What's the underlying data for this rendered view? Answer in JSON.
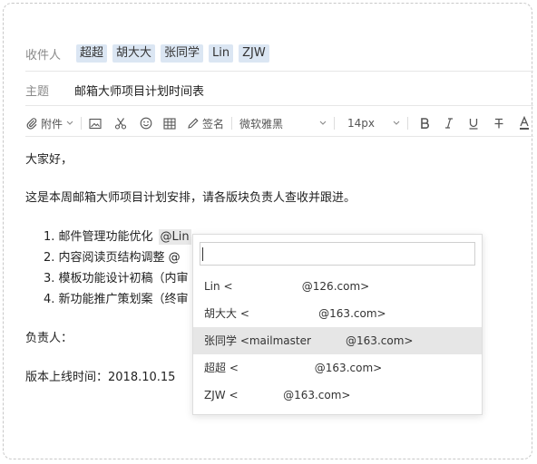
{
  "recipients": {
    "label": "收件人",
    "chips": [
      "超超",
      "胡大大",
      "张同学",
      "Lin",
      "ZJW"
    ]
  },
  "subject": {
    "label": "主题",
    "value": "邮箱大师项目计划时间表"
  },
  "toolbar": {
    "attach_label": "附件",
    "signature_label": "签名",
    "font_family": "微软雅黑",
    "font_size": "14px",
    "icons": [
      "paperclip-icon",
      "image-icon",
      "scissors-icon",
      "emoji-icon",
      "table-icon",
      "pen-icon",
      "bold-icon",
      "italic-icon",
      "underline-icon",
      "strikethrough-icon",
      "font-color-icon"
    ]
  },
  "body": {
    "greeting": "大家好，",
    "intro": "这是本周邮箱大师项目计划安排，请各版块负责人查收并跟进。",
    "items": [
      {
        "text": "1. 邮件管理功能优化",
        "mention": "@Lin"
      },
      {
        "text": "2. 内容阅读页结构调整 @"
      },
      {
        "text": "3. 模板功能设计初稿（内审"
      },
      {
        "text": "4. 新功能推广策划案（终审"
      }
    ],
    "owner_label": "负责人：",
    "release": "版本上线时间：2018.10.15"
  },
  "mention_popup": {
    "input_value": "",
    "options": [
      "Lin <                    @126.com>",
      "胡大大 <                    @163.com>",
      "张同学 <mailmaster          @163.com>",
      "超超 <                      @163.com>",
      "ZJW <             @163.com>"
    ],
    "selected_index": 2
  }
}
